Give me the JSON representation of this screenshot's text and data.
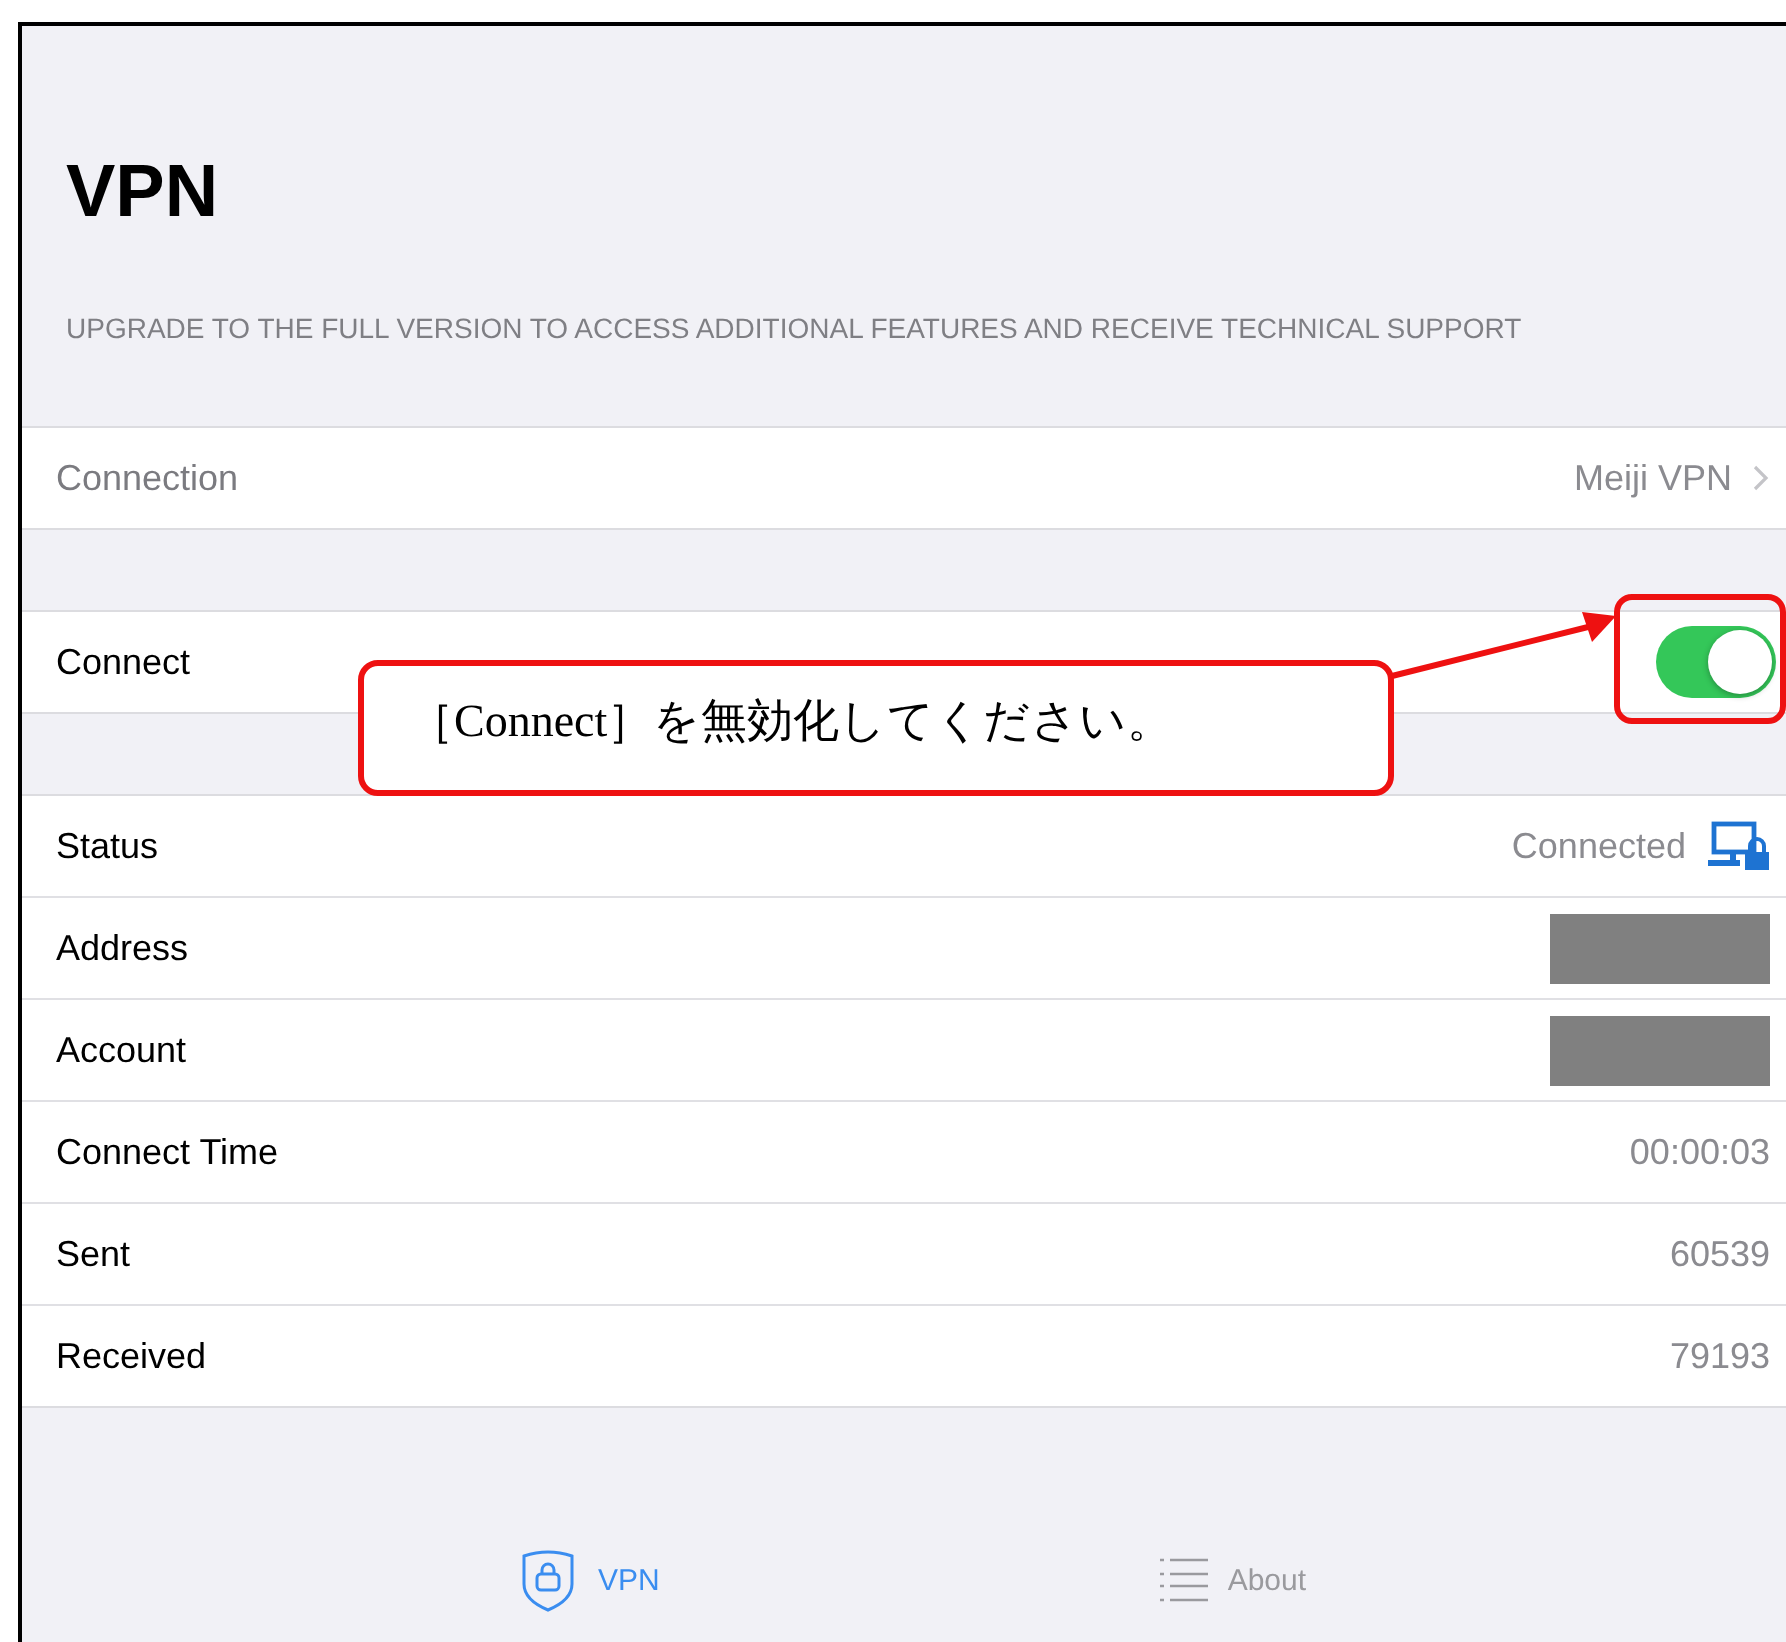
{
  "header": {
    "title": "VPN",
    "subtitle": "UPGRADE TO THE FULL VERSION TO ACCESS ADDITIONAL FEATURES AND RECEIVE TECHNICAL SUPPORT"
  },
  "connection": {
    "label": "Connection",
    "value": "Meiji VPN"
  },
  "connect": {
    "label": "Connect",
    "on": true
  },
  "details": [
    {
      "kind": "status",
      "label": "Status",
      "value": "Connected"
    },
    {
      "kind": "redacted",
      "label": "Address"
    },
    {
      "kind": "redacted",
      "label": "Account"
    },
    {
      "kind": "text",
      "label": "Connect Time",
      "value": "00:00:03"
    },
    {
      "kind": "text",
      "label": "Sent",
      "value": "60539"
    },
    {
      "kind": "text",
      "label": "Received",
      "value": "79193"
    }
  ],
  "tab_bar": [
    {
      "kind": "vpn",
      "label": "VPN",
      "selected": true
    },
    {
      "kind": "about",
      "label": "About",
      "selected": false
    }
  ],
  "annotation": {
    "text": "［Connect］を無効化してください。"
  }
}
